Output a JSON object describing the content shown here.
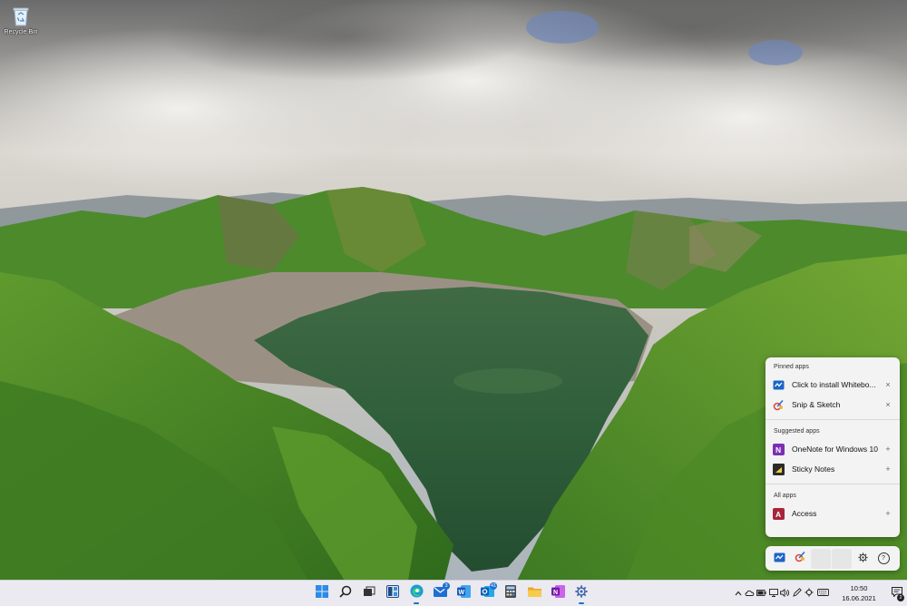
{
  "desktop": {
    "recycle_bin_label": "Recycle Bin"
  },
  "flyout": {
    "pinned_header": "Pinned apps",
    "pinned": [
      {
        "label": "Click to install Whitebo...",
        "icon": "whiteboard-icon",
        "action": "×"
      },
      {
        "label": "Snip & Sketch",
        "icon": "snip-sketch-icon",
        "action": "×"
      }
    ],
    "suggested_header": "Suggested apps",
    "suggested": [
      {
        "label": "OneNote for Windows 10",
        "icon": "onenote-icon",
        "action": "+"
      },
      {
        "label": "Sticky Notes",
        "icon": "sticky-notes-icon",
        "action": "+"
      }
    ],
    "all_header": "All apps",
    "all": [
      {
        "label": "Access",
        "icon": "access-icon",
        "action": "+"
      }
    ]
  },
  "strip": {
    "slots": [
      "whiteboard-icon",
      "snip-sketch-icon",
      "empty",
      "empty"
    ],
    "settings_icon": "gear-icon",
    "help_glyph": "?"
  },
  "taskbar": {
    "apps": [
      {
        "name": "start",
        "icon": "windows-logo-icon"
      },
      {
        "name": "search",
        "icon": "search-icon"
      },
      {
        "name": "task-view",
        "icon": "task-view-icon"
      },
      {
        "name": "widgets",
        "icon": "widgets-icon"
      },
      {
        "name": "edge",
        "icon": "edge-icon",
        "running": true
      },
      {
        "name": "mail",
        "icon": "mail-icon",
        "badge": "3"
      },
      {
        "name": "word",
        "icon": "word-icon"
      },
      {
        "name": "outlook",
        "icon": "outlook-icon",
        "badge": "41"
      },
      {
        "name": "calculator",
        "icon": "calculator-icon"
      },
      {
        "name": "file-explorer",
        "icon": "folder-icon"
      },
      {
        "name": "onenote",
        "icon": "onenote-icon"
      },
      {
        "name": "settings",
        "icon": "gear-icon",
        "running": true
      }
    ],
    "clock_time": "10:50",
    "clock_date": "16.06.2021",
    "notification_count": "2"
  },
  "colors": {
    "accent": "#1f6fd1",
    "taskbar_bg": "#eaeaf0",
    "flyout_bg": "#f3f3f3"
  }
}
